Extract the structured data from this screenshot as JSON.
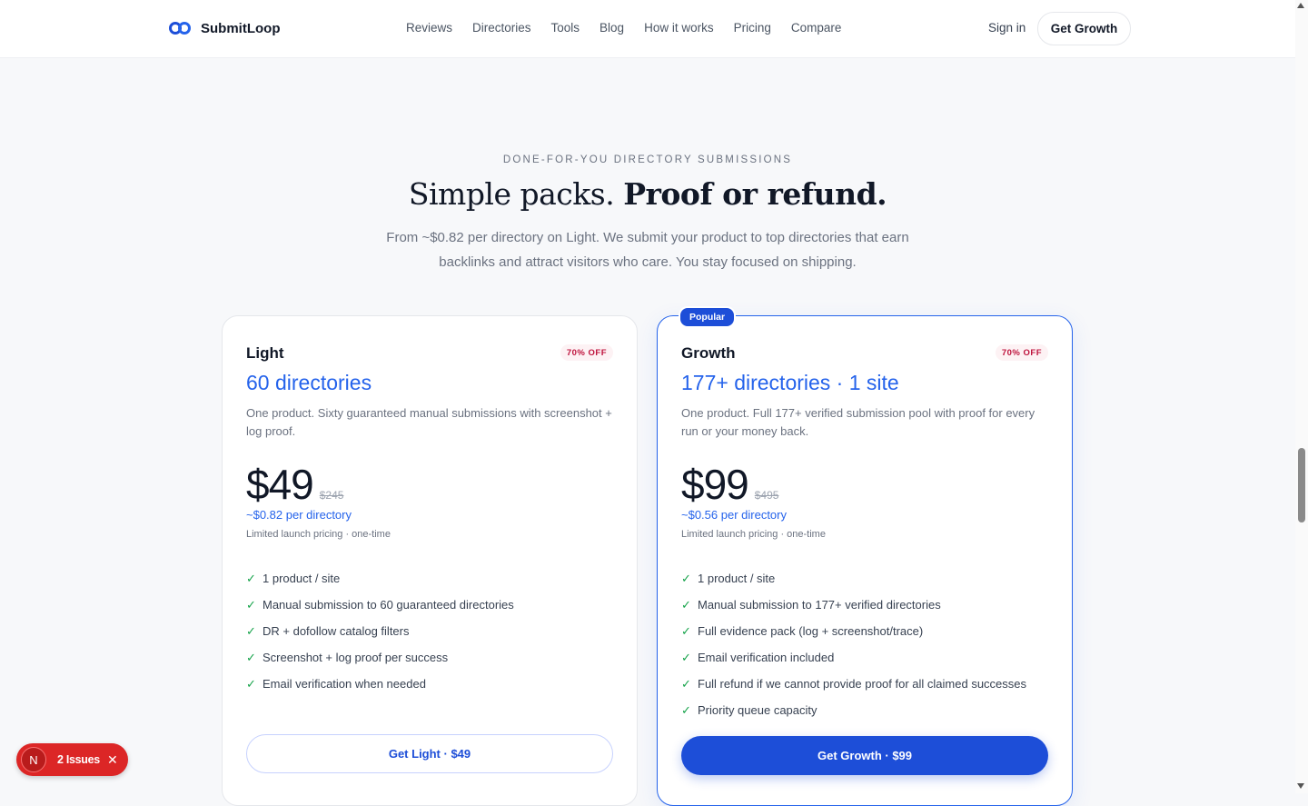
{
  "header": {
    "brand": "SubmitLoop",
    "nav": [
      "Reviews",
      "Directories",
      "Tools",
      "Blog",
      "How it works",
      "Pricing",
      "Compare"
    ],
    "sign_in": "Sign in",
    "cta": "Get Growth"
  },
  "hero": {
    "eyebrow": "DONE-FOR-YOU DIRECTORY SUBMISSIONS",
    "title_regular": "Simple packs.",
    "title_bold": "Proof or refund.",
    "subtitle": "From ~$0.82 per directory on Light. We submit your product to top directories that earn backlinks and attract visitors who care. You stay focused on shipping."
  },
  "plans": {
    "light": {
      "name": "Light",
      "discount": "70% OFF",
      "directories": "60 directories",
      "description": "One product. Sixty guaranteed manual submissions with screenshot + log proof.",
      "price": "$49",
      "old_price": "$245",
      "per_directory": "~$0.82 per directory",
      "note": "Limited launch pricing · one-time",
      "features": [
        "1 product / site",
        "Manual submission to 60 guaranteed directories",
        "DR + dofollow catalog filters",
        "Screenshot + log proof per success",
        "Email verification when needed"
      ],
      "button": "Get Light · $49"
    },
    "growth": {
      "badge": "Popular",
      "name": "Growth",
      "discount": "70% OFF",
      "directories": "177+ directories · 1 site",
      "description": "One product. Full 177+ verified submission pool with proof for every run or your money back.",
      "price": "$99",
      "old_price": "$495",
      "per_directory": "~$0.56 per directory",
      "note": "Limited launch pricing · one-time",
      "features": [
        "1 product / site",
        "Manual submission to 177+ verified directories",
        "Full evidence pack (log + screenshot/trace)",
        "Email verification included",
        "Full refund if we cannot provide proof for all claimed successes",
        "Priority queue capacity"
      ],
      "button": "Get Growth · $99"
    }
  },
  "issues_badge": {
    "avatar": "N",
    "text": "2 Issues"
  },
  "colors": {
    "accent": "#2563eb",
    "button": "#1d4ed8",
    "check": "#16a34a",
    "discount": "#be123c",
    "issues": "#dc2626"
  }
}
